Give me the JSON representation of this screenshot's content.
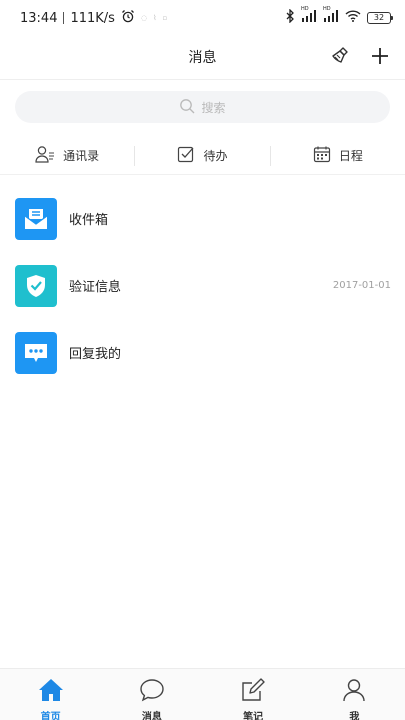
{
  "status_bar": {
    "time": "13:44",
    "speed": "111K/s",
    "faint_icons": [
      "◌",
      "⌇",
      "▫"
    ],
    "network_left": "HD",
    "network_right": "HD",
    "battery": "32"
  },
  "header": {
    "title": "消息",
    "clean_icon": "broom-icon",
    "add_icon": "plus-icon"
  },
  "search": {
    "placeholder": "搜索"
  },
  "quick_tabs": [
    {
      "label": "通讯录",
      "icon": "contacts-icon"
    },
    {
      "label": "待办",
      "icon": "checkbox-icon"
    },
    {
      "label": "日程",
      "icon": "calendar-icon"
    }
  ],
  "messages": [
    {
      "label": "收件箱",
      "time": "",
      "icon": "inbox-icon",
      "color": "#1e96f3"
    },
    {
      "label": "验证信息",
      "time": "2017-01-01",
      "icon": "shield-check-icon",
      "color": "#1fbfce"
    },
    {
      "label": "回复我的",
      "time": "",
      "icon": "chat-bubble-icon",
      "color": "#1e96f3"
    }
  ],
  "bottom_nav": [
    {
      "label": "首页",
      "icon": "home-icon",
      "active": true
    },
    {
      "label": "消息",
      "icon": "message-icon",
      "active": false
    },
    {
      "label": "笔记",
      "icon": "note-edit-icon",
      "active": false
    },
    {
      "label": "我",
      "icon": "person-icon",
      "active": false
    }
  ],
  "colors": {
    "accent": "#1e88e5",
    "inbox": "#1e96f3",
    "verify": "#1fbfce"
  }
}
